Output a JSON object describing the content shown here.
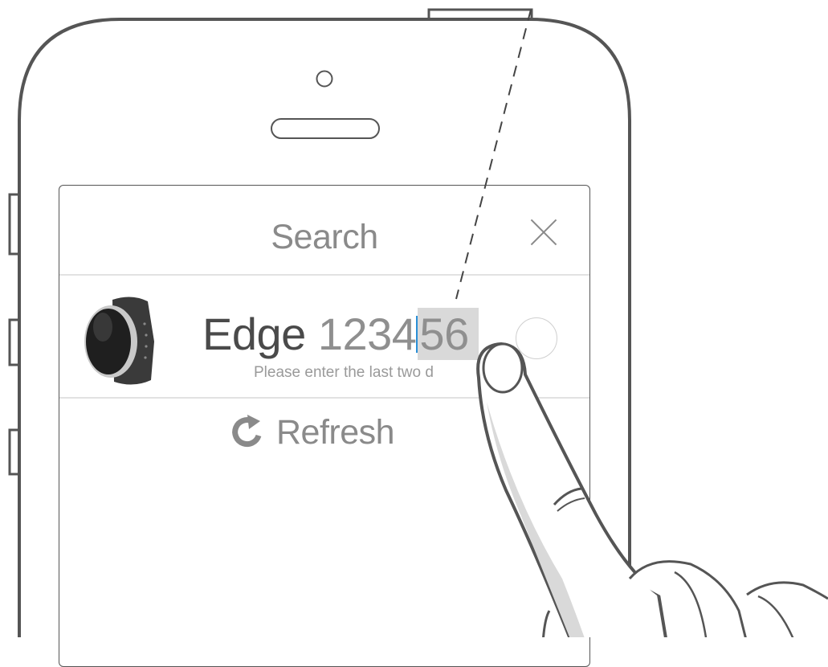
{
  "dialog": {
    "title": "Search",
    "close_icon": "close-x-icon"
  },
  "device": {
    "name_prefix": "Edge ",
    "code_dark": "1234",
    "code_light": "56",
    "hint": "Please enter the last two d",
    "icon": "smartwatch-icon"
  },
  "refresh": {
    "label": "Refresh",
    "icon": "refresh-icon"
  },
  "colors": {
    "outline": "#555555",
    "text_gray": "#8a8a8a",
    "caret": "#2a8fd6",
    "highlight": "#d9d9d9"
  }
}
